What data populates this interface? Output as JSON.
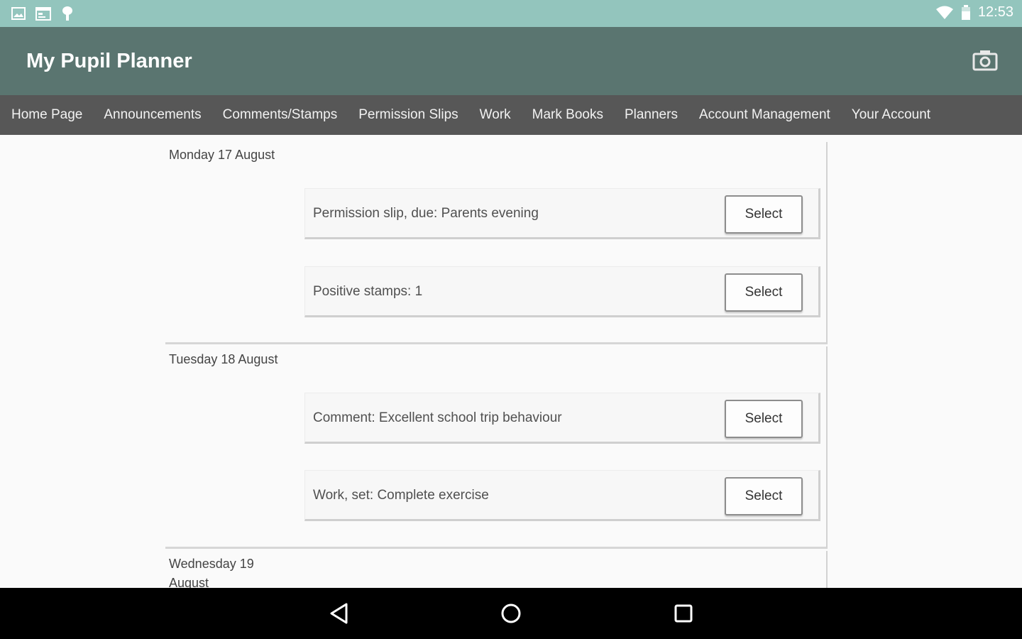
{
  "status_bar": {
    "icons_left": [
      "image-icon",
      "calendar-icon",
      "pin-icon"
    ],
    "icons_right": [
      "wifi-icon",
      "battery-icon"
    ],
    "time": "12:53"
  },
  "app_bar": {
    "title": "My Pupil Planner",
    "action_icon": "camera-icon"
  },
  "nav": {
    "items": [
      {
        "label": "Home Page"
      },
      {
        "label": "Announcements"
      },
      {
        "label": "Comments/Stamps"
      },
      {
        "label": "Permission Slips"
      },
      {
        "label": "Work"
      },
      {
        "label": "Mark Books"
      },
      {
        "label": "Planners"
      },
      {
        "label": "Account Management"
      },
      {
        "label": "Your Account"
      }
    ]
  },
  "days": [
    {
      "label": "Monday 17 August",
      "items": [
        {
          "text": "Permission slip, due: Parents evening",
          "button": "Select"
        },
        {
          "text": "Positive stamps: 1",
          "button": "Select"
        }
      ]
    },
    {
      "label": "Tuesday 18 August",
      "items": [
        {
          "text": "Comment: Excellent school trip behaviour",
          "button": "Select"
        },
        {
          "text": "Work, set: Complete exercise",
          "button": "Select"
        }
      ]
    },
    {
      "label": "Wednesday 19 August",
      "items": []
    }
  ],
  "system_nav": {
    "back": "back-icon",
    "home": "home-icon",
    "recents": "recents-icon"
  },
  "colors": {
    "status_bar": "#93c5bd",
    "app_bar": "#5a7570",
    "nav_bar": "#575757"
  }
}
